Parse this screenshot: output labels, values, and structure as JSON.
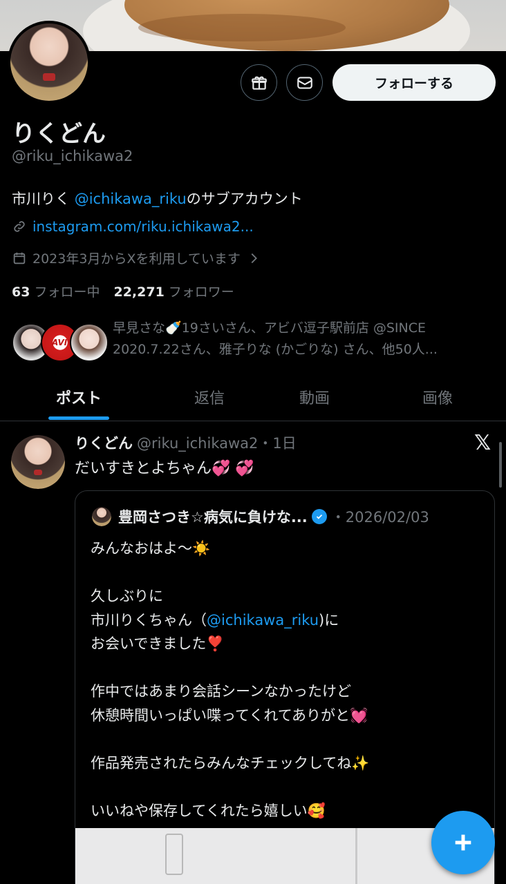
{
  "profile": {
    "display_name": "りくどん",
    "handle": "@riku_ichikawa2",
    "bio_prefix": "市川りく ",
    "bio_mention": "@ichikawa_riku",
    "bio_suffix": "のサブアカウント",
    "link": "instagram.com/riku.ichikawa2...",
    "joined": "2023年3月からXを利用しています",
    "following_count": "63",
    "following_label": "フォロー中",
    "followers_count": "22,271",
    "followers_label": "フォロワー",
    "followed_by_text": "早見さな🍼19さいさん、アビバ逗子駅前店 @SINCE 2020.7.22さん、雅子りな (かごりな) さん、他50人...",
    "follow_button": "フォローする"
  },
  "tabs": [
    "ポスト",
    "返信",
    "動画",
    "画像"
  ],
  "post": {
    "author_name": "りくどん",
    "author_meta": "@riku_ichikawa2・1日",
    "text": "だいすきとよちゃん💞 💞",
    "x_logo": "𝕏"
  },
  "quote": {
    "author_name": "豊岡さつき☆病気に負けな...",
    "date": "・2026/02/03",
    "line1": "みんなおはよ〜☀️",
    "line2": "久しぶりに",
    "line3_prefix": "市川りくちゃん（",
    "line3_mention": "@ichikawa_riku",
    "line3_suffix": ")に",
    "line4": "お会いできました❣️",
    "line5": "作中ではあまり会話シーンなかったけど",
    "line6": "休憩時間いっぱい喋ってくれてありがと💓",
    "line7": "作品発売されたらみんなチェックしてね✨",
    "line8": "いいねや保存してくれたら嬉しい🥰"
  },
  "mini_avatar_label": "AVIVA",
  "colors": {
    "accent": "#1d9bf0",
    "background": "#000000",
    "muted": "#71767b"
  },
  "icons": [
    "gift-icon",
    "mail-icon",
    "link-icon",
    "calendar-icon",
    "chevron-right-icon",
    "verified-icon",
    "compose-plus-icon",
    "x-logo-icon"
  ]
}
